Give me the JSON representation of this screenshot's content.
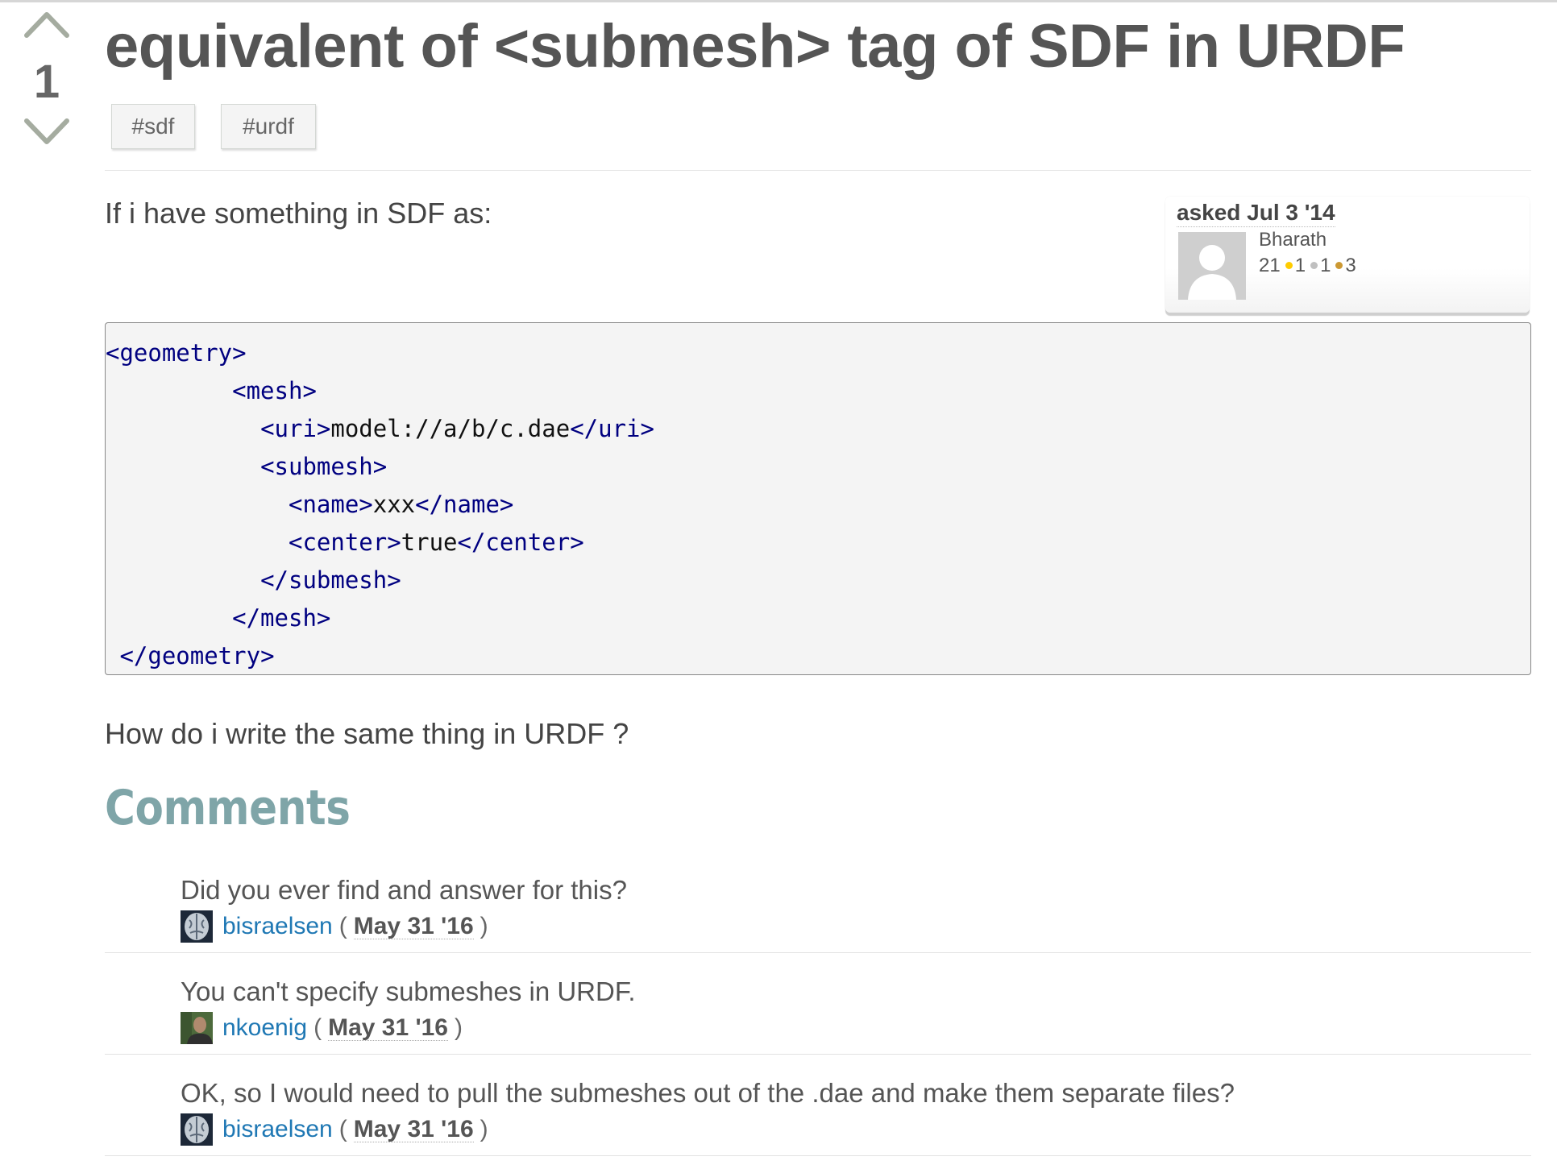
{
  "question": {
    "vote_count": "1",
    "title": "equivalent of <submesh> tag of SDF in URDF",
    "tags": [
      "#sdf",
      "#urdf"
    ],
    "intro_text": "If i have something in SDF as:",
    "outro_text": "How do i write the same thing in URDF ?"
  },
  "asker": {
    "asked_label": "asked Jul 3 '14",
    "name": "Bharath",
    "karma": "21",
    "gold": "1",
    "silver": "1",
    "bronze": "3"
  },
  "code": {
    "lines": [
      [
        {
          "t": "<geometry>",
          "k": 1
        }
      ],
      [
        {
          "t": "         ",
          "k": 0
        },
        {
          "t": "<mesh>",
          "k": 1
        }
      ],
      [
        {
          "t": "           ",
          "k": 0
        },
        {
          "t": "<uri>",
          "k": 1
        },
        {
          "t": "model://a/b/c.dae",
          "k": 0
        },
        {
          "t": "</uri>",
          "k": 1
        }
      ],
      [
        {
          "t": "           ",
          "k": 0
        },
        {
          "t": "<submesh>",
          "k": 1
        }
      ],
      [
        {
          "t": "             ",
          "k": 0
        },
        {
          "t": "<name>",
          "k": 1
        },
        {
          "t": "xxx",
          "k": 0
        },
        {
          "t": "</name>",
          "k": 1
        }
      ],
      [
        {
          "t": "             ",
          "k": 0
        },
        {
          "t": "<center>",
          "k": 1
        },
        {
          "t": "true",
          "k": 0
        },
        {
          "t": "</center>",
          "k": 1
        }
      ],
      [
        {
          "t": "           ",
          "k": 0
        },
        {
          "t": "</submesh>",
          "k": 1
        }
      ],
      [
        {
          "t": "         ",
          "k": 0
        },
        {
          "t": "</mesh>",
          "k": 1
        }
      ],
      [
        {
          "t": " ",
          "k": 0
        },
        {
          "t": "</geometry>",
          "k": 1
        }
      ]
    ]
  },
  "comments": {
    "heading": "Comments",
    "items": [
      {
        "text": "Did you ever find and answer for this?",
        "user": "bisraelsen",
        "date": "May 31 '16"
      },
      {
        "text": "You can't specify submeshes in URDF.",
        "user": "nkoenig",
        "date": "May 31 '16"
      },
      {
        "text": "OK, so I would need to pull the submeshes out of the .dae and make them separate files?",
        "user": "bisraelsen",
        "date": "May 31 '16"
      }
    ]
  },
  "colors": {
    "link": "#1f78b4",
    "code_tag": "#000080",
    "comments_heading": "#7fa5a8",
    "gold": "#ffcc00",
    "silver": "#c0c0c0",
    "bronze": "#cc9933"
  }
}
